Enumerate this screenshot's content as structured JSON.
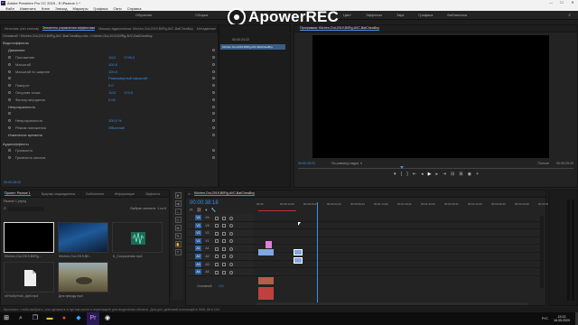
{
  "window": {
    "title": "Adobe Premiere Pro CC 2019 - E:\\Разное 1 *",
    "minimize": "—",
    "maximize": "☐",
    "close": "✕"
  },
  "menu": [
    "Файл",
    "Изменить",
    "Клип",
    "Эпизод",
    "Маркеры",
    "Графика",
    "Окно",
    "Справка"
  ],
  "workspaces": [
    "Обучение",
    "Сборка",
    "Редактирование",
    "Цвет",
    "Эффекты",
    "Звук",
    "Графика",
    "Библиотеки"
  ],
  "recorder": {
    "text": "ApowerREC"
  },
  "source_tabs": [
    "Источник: (нет клипов)",
    "Элементы управления эффектами",
    "Микшер аудиоклипов: Kitchen,Out,2019,B0Rg,AVC,BatCheaBoy",
    "Метаданные"
  ],
  "effects": {
    "header_path": "Основной * Kitchen,Out,2019,B0Rg,AVC,BatCheaBoy,m4s  >  Kitchen,Out,2019,B0Rg,AVC,BatCheaBoy",
    "clip_timecode": "00:00:24:22",
    "clip_label": "Kitchen,Out,2019,B0Rg,AVC,BatCheaBoy",
    "video_effects_label": "Видеоэффекты",
    "rows": [
      {
        "label": "Движение",
        "hdr": true
      },
      {
        "label": "Положение",
        "v1": "1112",
        "v2": "1746,0"
      },
      {
        "label": "Масштаб",
        "v1": "100,0"
      },
      {
        "label": "Масштаб по ширине",
        "v1": "100,0"
      },
      {
        "label": "",
        "v1": "Равномерный масштаб"
      },
      {
        "label": "Поворот",
        "v1": "0,0"
      },
      {
        "label": "Опорная точка",
        "v1": "1112",
        "v2": "174,0"
      },
      {
        "label": "Фильтр мерцания",
        "v1": "0,00"
      },
      {
        "label": "Непрозрачность",
        "hdr": true
      },
      {
        "label": "",
        "v1": ""
      },
      {
        "label": "Непрозрачность",
        "v1": "100,0 %"
      },
      {
        "label": "Режим наложения",
        "v1": "Обычный"
      },
      {
        "label": "Изменение времени",
        "hdr": true
      }
    ],
    "audio_effects_label": "Аудиоэффекты",
    "audio_rows": [
      {
        "label": "Громкость"
      },
      {
        "label": "Громкость канала"
      }
    ],
    "bottom_timecode": "00:00:28:22"
  },
  "program": {
    "tab": "Программа: Kitchen,Out,2019,B0Rg,AVC,BatCheaBoy",
    "timecode_left": "00:00:28:22",
    "fit": "По размеру кадра",
    "timecode_right": "00:00:29:22",
    "quality": "Полное"
  },
  "project": {
    "tabs": [
      "Проект: Разное 1",
      "Браузер медиаданных",
      "Библиотеки",
      "Информация",
      "Эффекты"
    ],
    "file": "Разное 1.prproj",
    "count": "Выбран элемент: 1 из 6",
    "search_placeholder": "",
    "items": [
      {
        "name": "Kitchen,Out,2019,B0Rg...",
        "dur": "28:22"
      },
      {
        "name": "Kitchen,Out,2019,B0...",
        "dur": "5:0"
      },
      {
        "name": "Б_Сохранение.mp4",
        "dur": "0:12:39:05"
      },
      {
        "name": "пЛ%d0p%d0_Ajell.mp4",
        "dur": "11:4"
      },
      {
        "name": "Для пригдд.mp4",
        "dur": "25:39"
      }
    ]
  },
  "timeline": {
    "tab": "Kitchen,Out,2019,B0Rg,AVC,BatCheaBoy",
    "timecode": "00:00:38:18",
    "ruler": [
      "00:00",
      "00:00:14:23",
      "00:00:29:23",
      "00:00:44:22",
      "00:00:59:22",
      "00:01:14:22",
      "00:01:29:21",
      "00:01:44:21",
      "00:01:59:21",
      "00:02:14:20",
      "00:02:29:20",
      "00:02:44:20",
      "00:02:59"
    ],
    "tracks": [
      "V4",
      "V3",
      "V2",
      "V1",
      "A1",
      "A2",
      "A3",
      "A4"
    ],
    "master_label": "Основной",
    "master_value": "0,0"
  },
  "status_bar": "Щелкните, чтобы выбрать, или щелкните в пустом месте и перетащите для выделения области. Для доп. действий используйте Shift, Alt и Ctrl.",
  "taskbar": {
    "time": "15:22",
    "date": "16.05.2020",
    "lang": "РУС"
  },
  "colors": {
    "accent": "#3d8fe6",
    "clip_pink": "#e47fd8",
    "clip_blue": "#7fa8e0",
    "clip_red": "#c04040",
    "clip_audio": "#b85b4a"
  }
}
